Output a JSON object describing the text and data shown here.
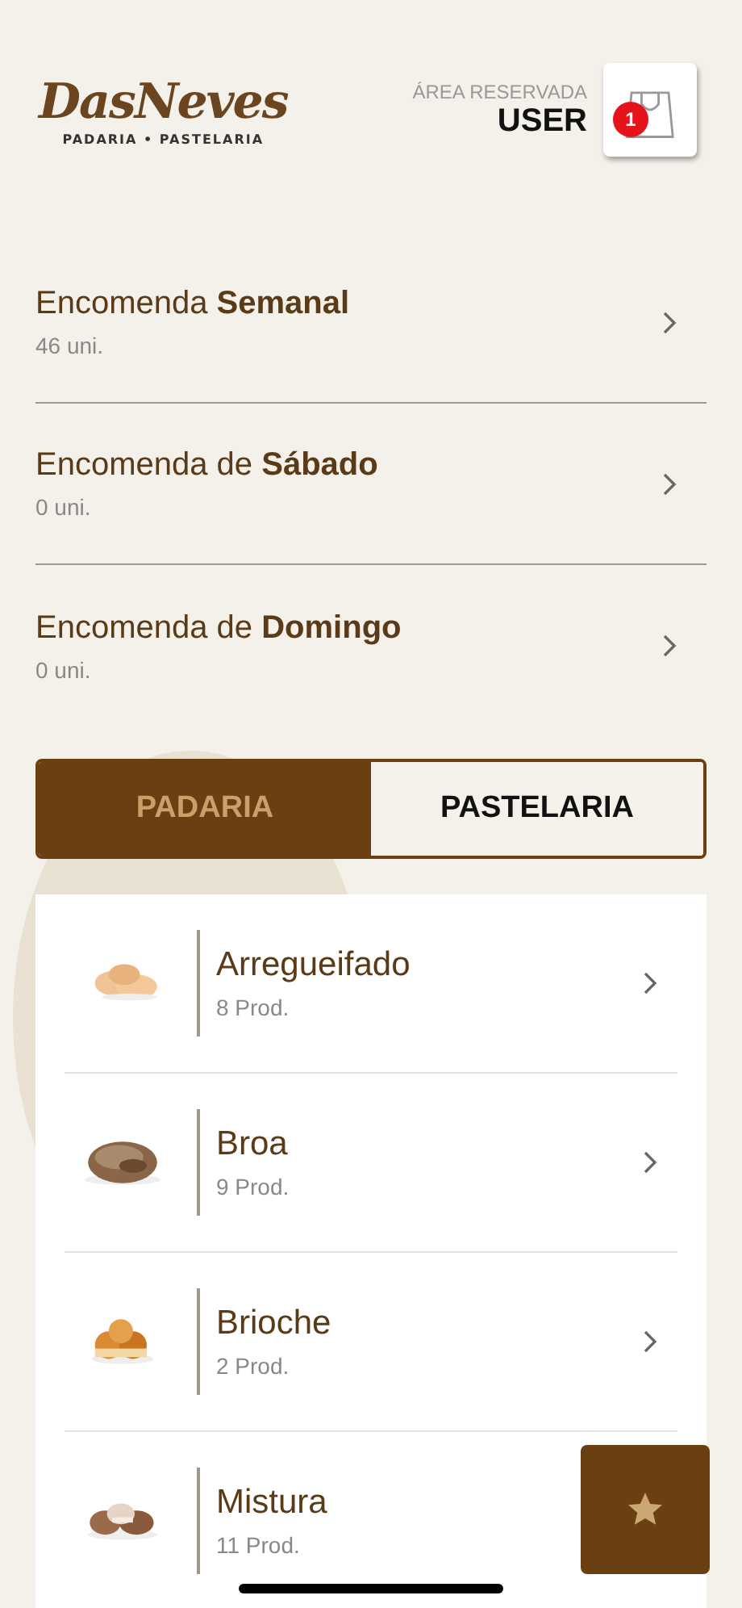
{
  "header": {
    "logo": {
      "name": "DasNeves",
      "tagline": "PADARIA • PASTELARIA"
    },
    "account": {
      "label": "ÁREA RESERVADA",
      "user": "USER"
    },
    "cart": {
      "count": "1"
    }
  },
  "orders": [
    {
      "title": "Encomenda **Semanal**",
      "count": "46 uni."
    },
    {
      "title": "Encomenda de **Sábado**",
      "count": "0 uni."
    },
    {
      "title": "Encomenda de **Domingo**",
      "count": "0 uni."
    }
  ],
  "tabs": [
    {
      "label": "PADARIA",
      "selected": true
    },
    {
      "label": "PASTELARIA",
      "selected": false
    }
  ],
  "categories": [
    {
      "name": "Arregueifado",
      "count": "8 Prod."
    },
    {
      "name": "Broa",
      "count": "9 Prod."
    },
    {
      "name": "Brioche",
      "count": "2 Prod."
    },
    {
      "name": "Mistura",
      "count": "11 Prod."
    }
  ]
}
